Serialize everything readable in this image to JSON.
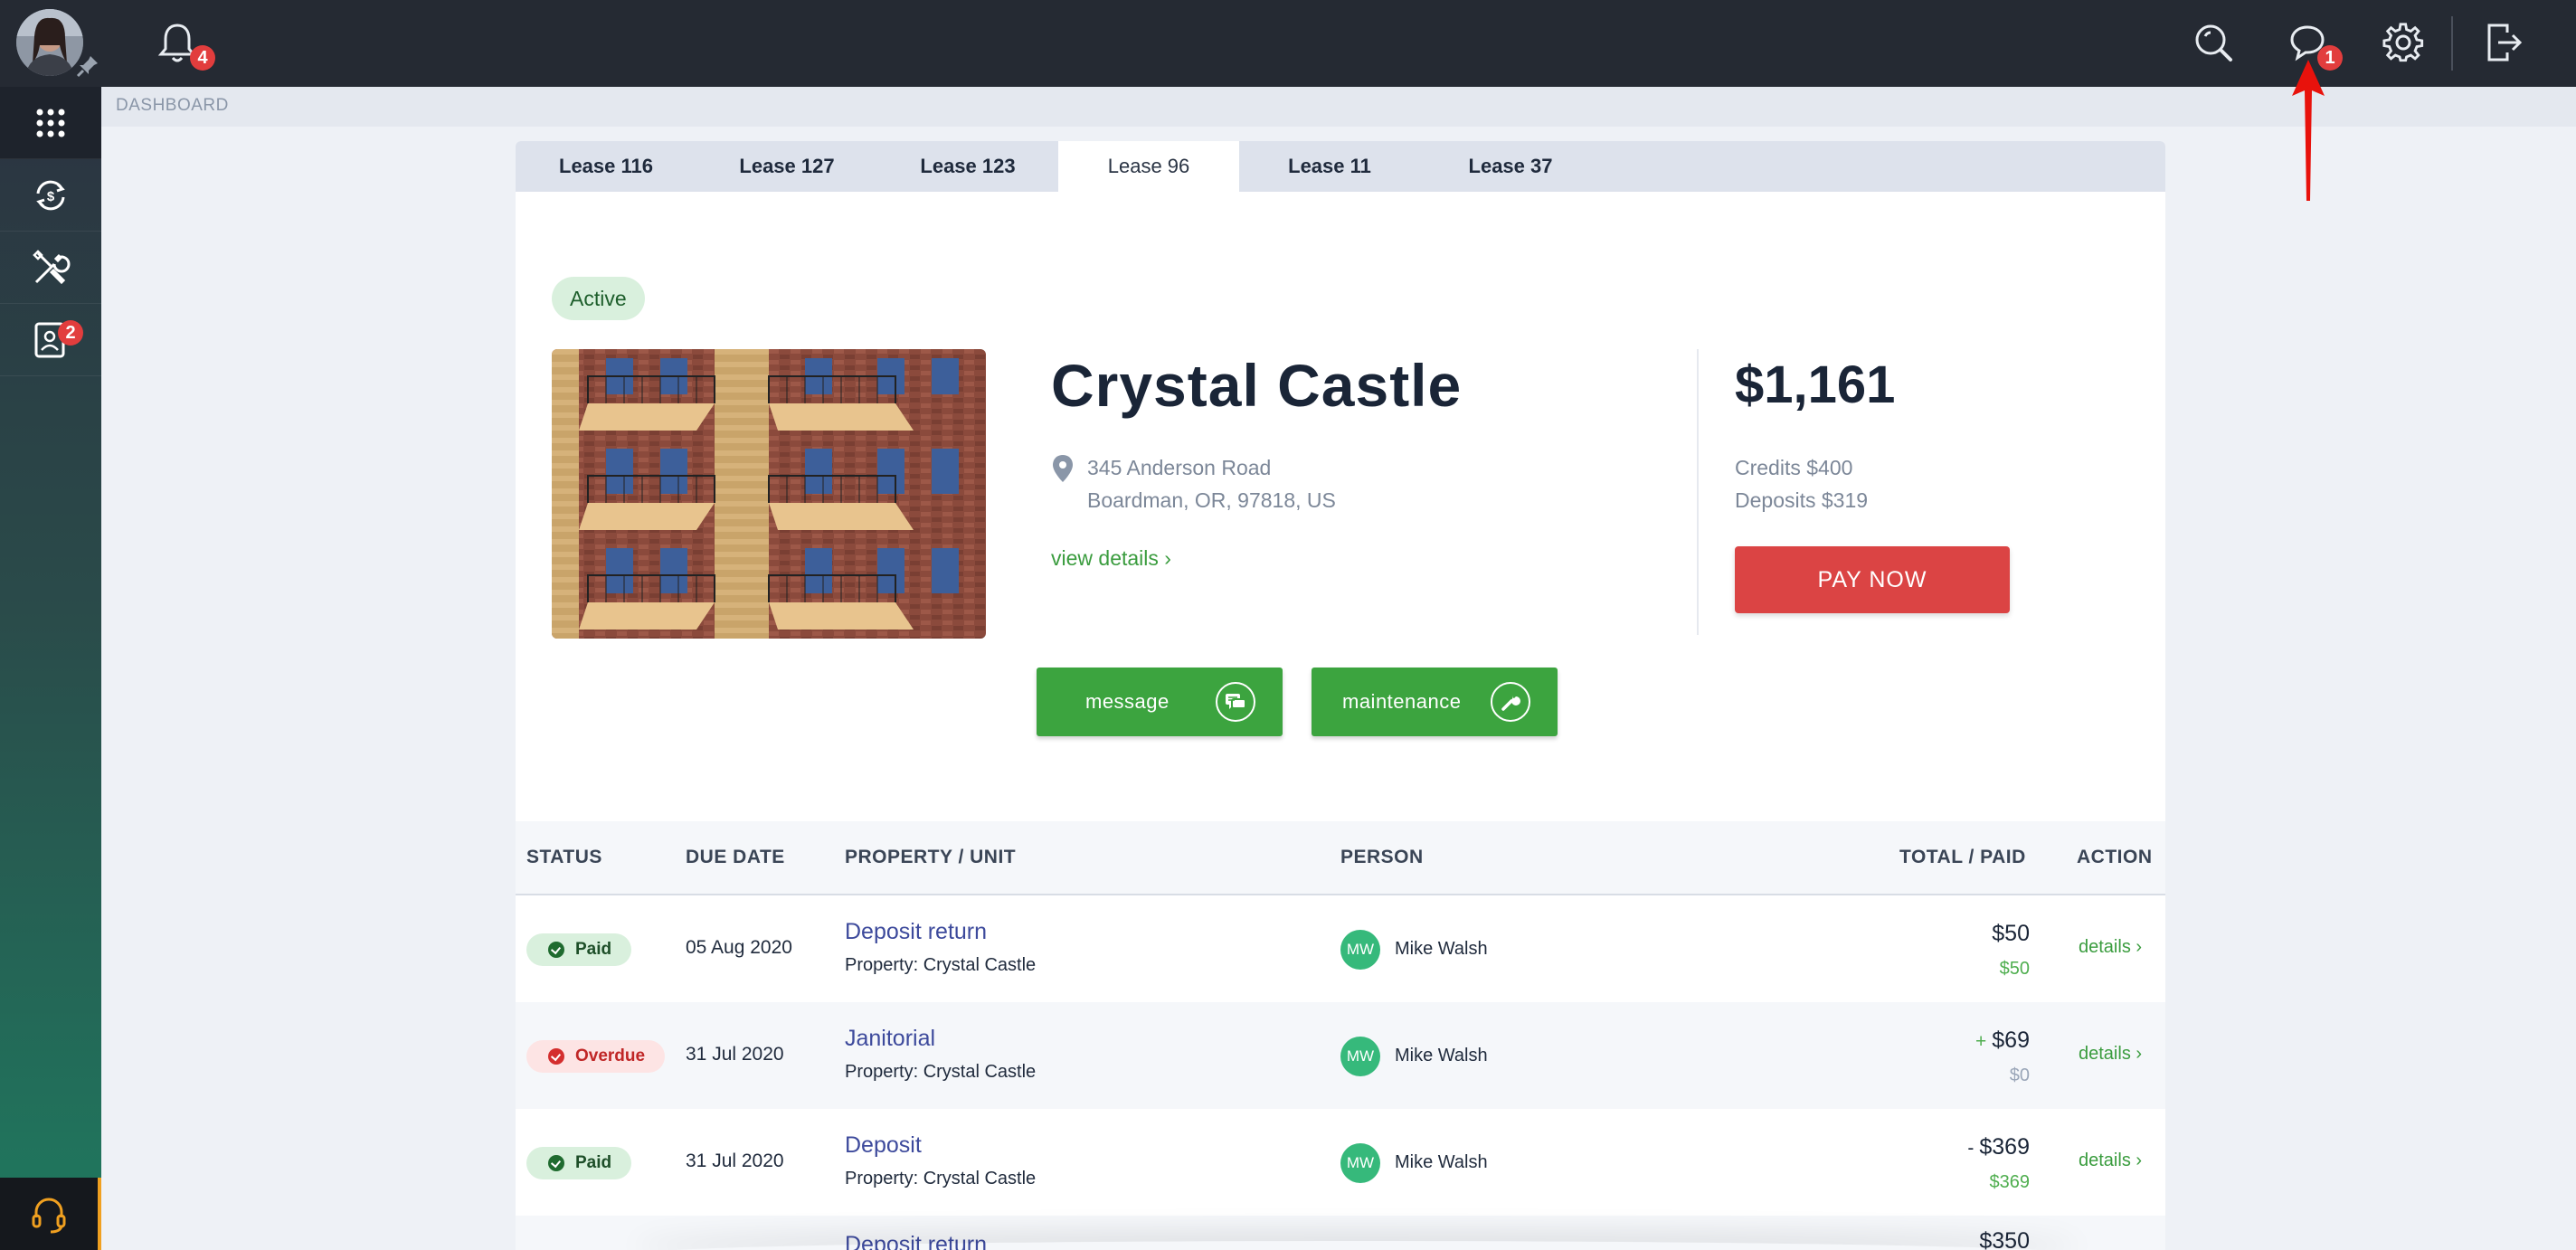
{
  "topbar": {
    "notifications_count": "4",
    "messages_count": "1"
  },
  "sidebar": {
    "reports_badge": "2"
  },
  "breadcrumb": "DASHBOARD",
  "tabs": [
    {
      "label": "Lease 116"
    },
    {
      "label": "Lease 127"
    },
    {
      "label": "Lease 123"
    },
    {
      "label": "Lease 96"
    },
    {
      "label": "Lease 11"
    },
    {
      "label": "Lease 37"
    }
  ],
  "lease": {
    "status": "Active",
    "property_name": "Crystal Castle",
    "address_line1": "345 Anderson Road",
    "address_line2": "Boardman, OR, 97818, US",
    "view_details": "view details",
    "amount": "$1,161",
    "credits": "Credits $400",
    "deposits": "Deposits $319",
    "pay_now": "PAY NOW",
    "message_label": "message",
    "maintenance_label": "maintenance"
  },
  "table": {
    "headers": {
      "status": "STATUS",
      "due_date": "DUE DATE",
      "property": "PROPERTY / UNIT",
      "person": "PERSON",
      "total": "TOTAL / PAID",
      "action": "ACTION"
    },
    "rows": [
      {
        "status": "Paid",
        "due": "05 Aug 2020",
        "title": "Deposit return",
        "sub": "Property: Crystal Castle",
        "initials": "MW",
        "person": "Mike Walsh",
        "sign": "",
        "total": "$50",
        "paid": "$50",
        "action": "details"
      },
      {
        "status": "Overdue",
        "due": "31 Jul 2020",
        "title": "Janitorial",
        "sub": "Property: Crystal Castle",
        "initials": "MW",
        "person": "Mike Walsh",
        "sign": "+",
        "total": "$69",
        "paid": "$0",
        "action": "details"
      },
      {
        "status": "Paid",
        "due": "31 Jul 2020",
        "title": "Deposit",
        "sub": "Property: Crystal Castle",
        "initials": "MW",
        "person": "Mike Walsh",
        "sign": "-",
        "total": "$369",
        "paid": "$369",
        "action": "details"
      },
      {
        "status": "",
        "due": "",
        "title": "Deposit return",
        "sub": "",
        "initials": "",
        "person": "",
        "sign": "",
        "total": "$350",
        "paid": "",
        "action": ""
      }
    ]
  },
  "colors": {
    "accent_green": "#3ca43f",
    "pay_red": "#db4444",
    "topbar": "#252a33",
    "paid_text": "#4fae4f",
    "unpaid_text": "#9aa6b8"
  }
}
